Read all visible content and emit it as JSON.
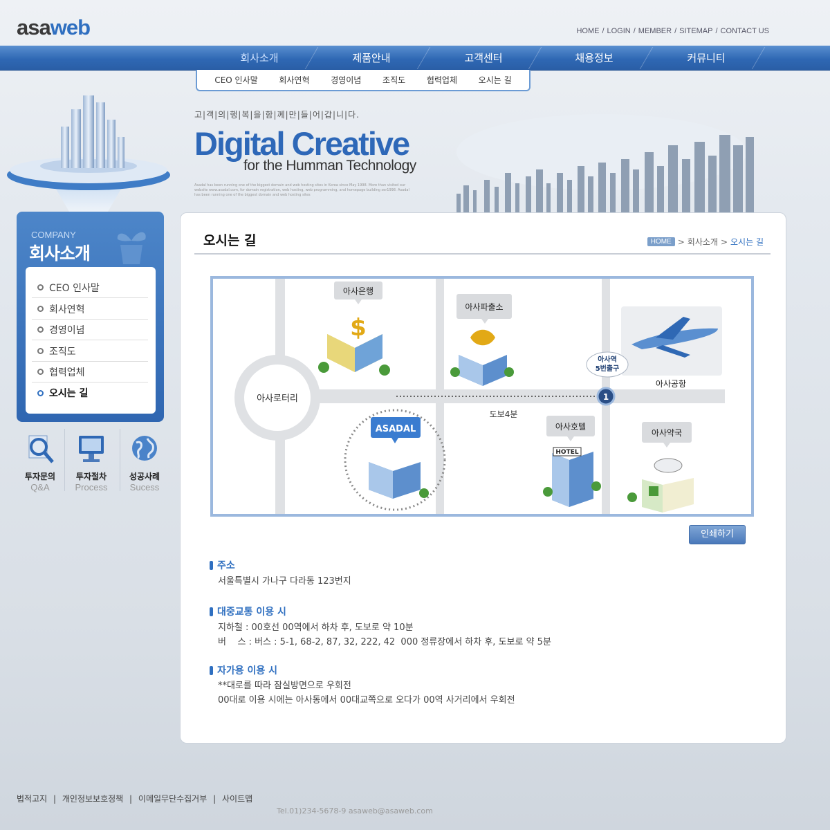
{
  "logo": {
    "part1": "asa",
    "part2": "web"
  },
  "top_links": [
    "HOME",
    "LOGIN",
    "MEMBER",
    "SITEMAP",
    "CONTACT US"
  ],
  "top_sep": "/",
  "gnb": [
    "회사소개",
    "제품안내",
    "고객센터",
    "채용정보",
    "커뮤니티"
  ],
  "subnav": [
    "CEO 인사말",
    "회사연혁",
    "경영이념",
    "조직도",
    "협력업체",
    "오시는 길"
  ],
  "hero": {
    "slogan": "고|객|의|행|복|을|함|께|만|들|어|갑|니|다.",
    "title": "Digital Creative",
    "subtitle": "for the Humman Technology",
    "small": "Asadal has been running one of the biggest domain and web hosting sites in Korea since May 1998. More than visited our website www.asadal.com, for domain registration, web hosting, web programming, and homepage building ser1998. Asadal has been running one of the biggest domain and web hosting sites"
  },
  "left": {
    "company": "COMPANY",
    "title": "회사소개",
    "items": [
      "CEO 인사말",
      "회사연혁",
      "경영이념",
      "조직도",
      "협력업체",
      "오시는 길"
    ]
  },
  "quick": [
    {
      "label": "투자문의",
      "sub": "Q&A"
    },
    {
      "label": "투자절차",
      "sub": "Process"
    },
    {
      "label": "성공사례",
      "sub": "Sucess"
    }
  ],
  "page": {
    "title": "오시는 길",
    "breadcrumb": {
      "home": "HOME",
      "sep": ">",
      "section": "회사소개",
      "current": "오시는 길"
    }
  },
  "map": {
    "rotary": "아사로터리",
    "bank": "아사은행",
    "police": "아사파출소",
    "station": "아사역 5번출구",
    "station_num": "1",
    "airport": "아사공항",
    "walk": "도보4분",
    "company": "ASADAL",
    "hotel": "아사호텔",
    "hotel_sign": "HOTEL",
    "pharmacy": "아사약국",
    "dollar": "$"
  },
  "print_label": "인쇄하기",
  "info": {
    "address_h": "주소",
    "address": "서울특별시 가나구 다라동 123번지",
    "transit_h": "대중교통 이용 시",
    "transit": [
      "지하철 : 00호선 00역에서 하차 후, 도보로 약 10분",
      "버    스 : 버스 : 5-1, 68-2, 87, 32, 222, 42  000 정류장에서 하차 후, 도보로 약 5분"
    ],
    "car_h": "자가용 이용 시",
    "car": [
      "**대로를 따라 잠실방면으로 우회전",
      "00대로 이용 시에는 아사동에서 00대교쪽으로 오다가 00역 사거리에서 우회전"
    ]
  },
  "footer": {
    "links": [
      "법적고지",
      "개인정보보호정책",
      "이메일무단수집거부",
      "사이트맵"
    ],
    "sep": "|",
    "line2": "Tel.01)234-5678-9  asaweb@asaweb.com"
  },
  "colors": {
    "brand": "#2f6fc0",
    "nav": "#2f68b4"
  }
}
